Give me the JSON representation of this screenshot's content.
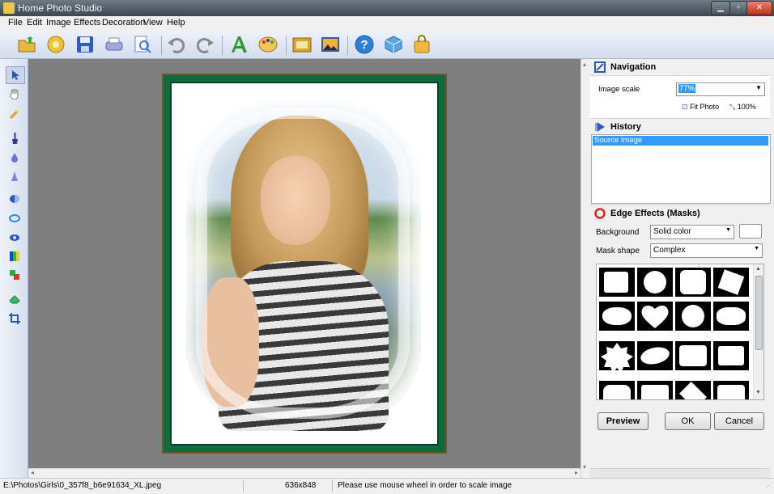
{
  "window": {
    "title": "Home Photo Studio",
    "controls": [
      "minimize-icon",
      "maximize-icon",
      "close-icon"
    ]
  },
  "menu": [
    "File",
    "Edit",
    "Image",
    "Effects",
    "Decoration",
    "View",
    "Help"
  ],
  "toolbar": {
    "buttons": [
      "open-icon",
      "browse-icon",
      "save-icon",
      "print-icon",
      "print-preview-icon",
      "undo-icon",
      "redo-icon",
      "text-icon",
      "palette-icon",
      "frame-icon",
      "picture-icon",
      "help-icon",
      "package-icon",
      "shop-icon"
    ]
  },
  "tools": [
    "arrow-icon",
    "hand-icon",
    "wand-icon",
    "brush-icon",
    "drop-icon",
    "cone-icon",
    "contrast-icon",
    "lens-icon",
    "eye-icon",
    "color-adjust-icon",
    "replace-color-icon",
    "eraser-icon",
    "crop-icon"
  ],
  "navigation": {
    "title": "Navigation",
    "scale_label": "Image scale",
    "scale_value": "77%",
    "fit_label": "Fit Photo",
    "full_label": "100%"
  },
  "history": {
    "title": "History",
    "items": [
      "Source Image"
    ]
  },
  "edge_effects": {
    "title": "Edge Effects (Masks)",
    "background_label": "Background",
    "background_value": "Solid color",
    "mask_label": "Mask shape",
    "mask_value": "Complex",
    "preview_label": "Preview",
    "ok_label": "OK",
    "cancel_label": "Cancel"
  },
  "status": {
    "path": "E:\\Photos\\Girls\\0_357f8_b6e91634_XL.jpeg",
    "size": "636x848",
    "hint": "Please use mouse wheel in order to scale image"
  },
  "colors": {
    "frame": "#0f6a3c",
    "accent": "#3399ff"
  }
}
